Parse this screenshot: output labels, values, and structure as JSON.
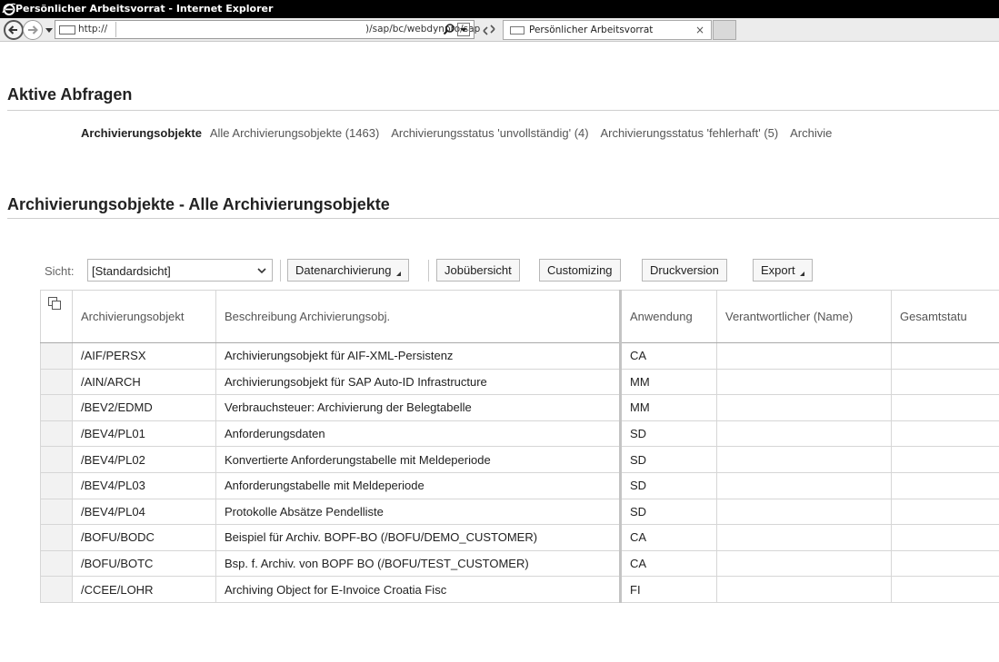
{
  "window": {
    "title": "Persönlicher Arbeitsvorrat - Internet Explorer"
  },
  "browser": {
    "url_prefix": "http://",
    "url_suffix": ")/sap/bc/webdynpro/sap",
    "tab_label": "Persönlicher Arbeitsvorrat",
    "tab_close": "×"
  },
  "page": {
    "aktive_heading": "Aktive Abfragen",
    "queries_heading": "Archivierungsobjekte",
    "queries": [
      "Alle Archivierungsobjekte (1463)",
      "Archivierungsstatus 'unvollständig' (4)",
      "Archivierungsstatus 'fehlerhaft' (5)",
      "Archivie"
    ],
    "section_heading": "Archivierungsobjekte - Alle Archivierungsobjekte"
  },
  "toolbar": {
    "sicht_label": "Sicht:",
    "sicht_value": "[Standardsicht]",
    "buttons": {
      "datenarchivierung": "Datenarchivierung",
      "jobuebersicht": "Jobübersicht",
      "customizing": "Customizing",
      "druckversion": "Druckversion",
      "export": "Export"
    }
  },
  "table": {
    "columns": {
      "objekt": "Archivierungsobjekt",
      "beschreibung": "Beschreibung Archivierungsobj.",
      "anwendung": "Anwendung",
      "verantwortlicher": "Verantwortlicher (Name)",
      "gesamtstatus": "Gesamtstatu"
    },
    "rows": [
      {
        "objekt": "/AIF/PERSX",
        "beschreibung": "Archivierungsobjekt für AIF-XML-Persistenz",
        "anwendung": "CA",
        "verantwortlicher": "",
        "gesamtstatus": ""
      },
      {
        "objekt": "/AIN/ARCH",
        "beschreibung": "Archivierungsobjekt für SAP Auto-ID Infrastructure",
        "anwendung": "MM",
        "verantwortlicher": "",
        "gesamtstatus": ""
      },
      {
        "objekt": "/BEV2/EDMD",
        "beschreibung": "Verbrauchsteuer: Archivierung der Belegtabelle",
        "anwendung": "MM",
        "verantwortlicher": "",
        "gesamtstatus": ""
      },
      {
        "objekt": "/BEV4/PL01",
        "beschreibung": "Anforderungsdaten",
        "anwendung": "SD",
        "verantwortlicher": "",
        "gesamtstatus": ""
      },
      {
        "objekt": "/BEV4/PL02",
        "beschreibung": "Konvertierte Anforderungstabelle mit Meldeperiode",
        "anwendung": "SD",
        "verantwortlicher": "",
        "gesamtstatus": ""
      },
      {
        "objekt": "/BEV4/PL03",
        "beschreibung": "Anforderungstabelle mit Meldeperiode",
        "anwendung": "SD",
        "verantwortlicher": "",
        "gesamtstatus": ""
      },
      {
        "objekt": "/BEV4/PL04",
        "beschreibung": "Protokolle Absätze Pendelliste",
        "anwendung": "SD",
        "verantwortlicher": "",
        "gesamtstatus": ""
      },
      {
        "objekt": "/BOFU/BODC",
        "beschreibung": "Beispiel für Archiv. BOPF-BO (/BOFU/DEMO_CUSTOMER)",
        "anwendung": "CA",
        "verantwortlicher": "",
        "gesamtstatus": ""
      },
      {
        "objekt": "/BOFU/BOTC",
        "beschreibung": "Bsp. f. Archiv. von BOPF BO (/BOFU/TEST_CUSTOMER)",
        "anwendung": "CA",
        "verantwortlicher": "",
        "gesamtstatus": ""
      },
      {
        "objekt": "/CCEE/LOHR",
        "beschreibung": "Archiving Object for E-Invoice Croatia Fisc",
        "anwendung": "FI",
        "verantwortlicher": "",
        "gesamtstatus": ""
      }
    ]
  }
}
